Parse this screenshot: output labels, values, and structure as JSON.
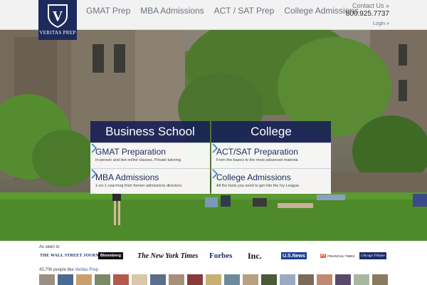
{
  "brand": {
    "name": "VERITAS PREP",
    "logo_letter": "V",
    "color": "#1d2a5c"
  },
  "nav": {
    "items": [
      {
        "label": "GMAT Prep"
      },
      {
        "label": "MBA Admissions"
      },
      {
        "label": "ACT / SAT Prep"
      },
      {
        "label": "College Admissions"
      }
    ]
  },
  "contact": {
    "link_label": "Contact Us »",
    "phone": "800.925.7737",
    "login_label": "Login »"
  },
  "panels": [
    {
      "title": "Business School",
      "items": [
        {
          "title": "GMAT Preparation",
          "subtitle": "In-person and live online classes. Private tutoring.",
          "icon": "chevron-right-icon"
        },
        {
          "title": "MBA Admissions",
          "subtitle": "1-on-1 coaching from former admissions directors.",
          "icon": "chevron-right-icon"
        }
      ]
    },
    {
      "title": "College",
      "items": [
        {
          "title": "ACT/SAT Preparation",
          "subtitle": "From the basics to the most advanced material.",
          "icon": "chevron-right-icon"
        },
        {
          "title": "College Admissions",
          "subtitle": "All the tools you need to get into the Ivy League.",
          "icon": "chevron-right-icon"
        }
      ]
    }
  ],
  "as_seen_in": {
    "label": "As seen in:",
    "outlets": [
      "THE WALL STREET JOURNAL",
      "Bloomberg",
      "The New York Times",
      "Forbes",
      "Inc.",
      "U.S.News",
      "FINANCIAL TIMES",
      "Chicago Tribune"
    ],
    "ft_mark": "FT"
  },
  "social": {
    "count_text": "43,706 people like",
    "page_link": "Veritas Prep",
    "face_colors": [
      "#9a8f85",
      "#4a6b8f",
      "#c9a06b",
      "#7a8a66",
      "#b45a4a",
      "#d8c8a8",
      "#5b6e8c",
      "#a89078",
      "#8a3a3a",
      "#c8b070",
      "#6e8a9a",
      "#b8a080",
      "#4a5a3a",
      "#9aaac0",
      "#7a6a5a",
      "#c08a70",
      "#5a4a6a",
      "#a8b8a0",
      "#8a7a60"
    ]
  }
}
